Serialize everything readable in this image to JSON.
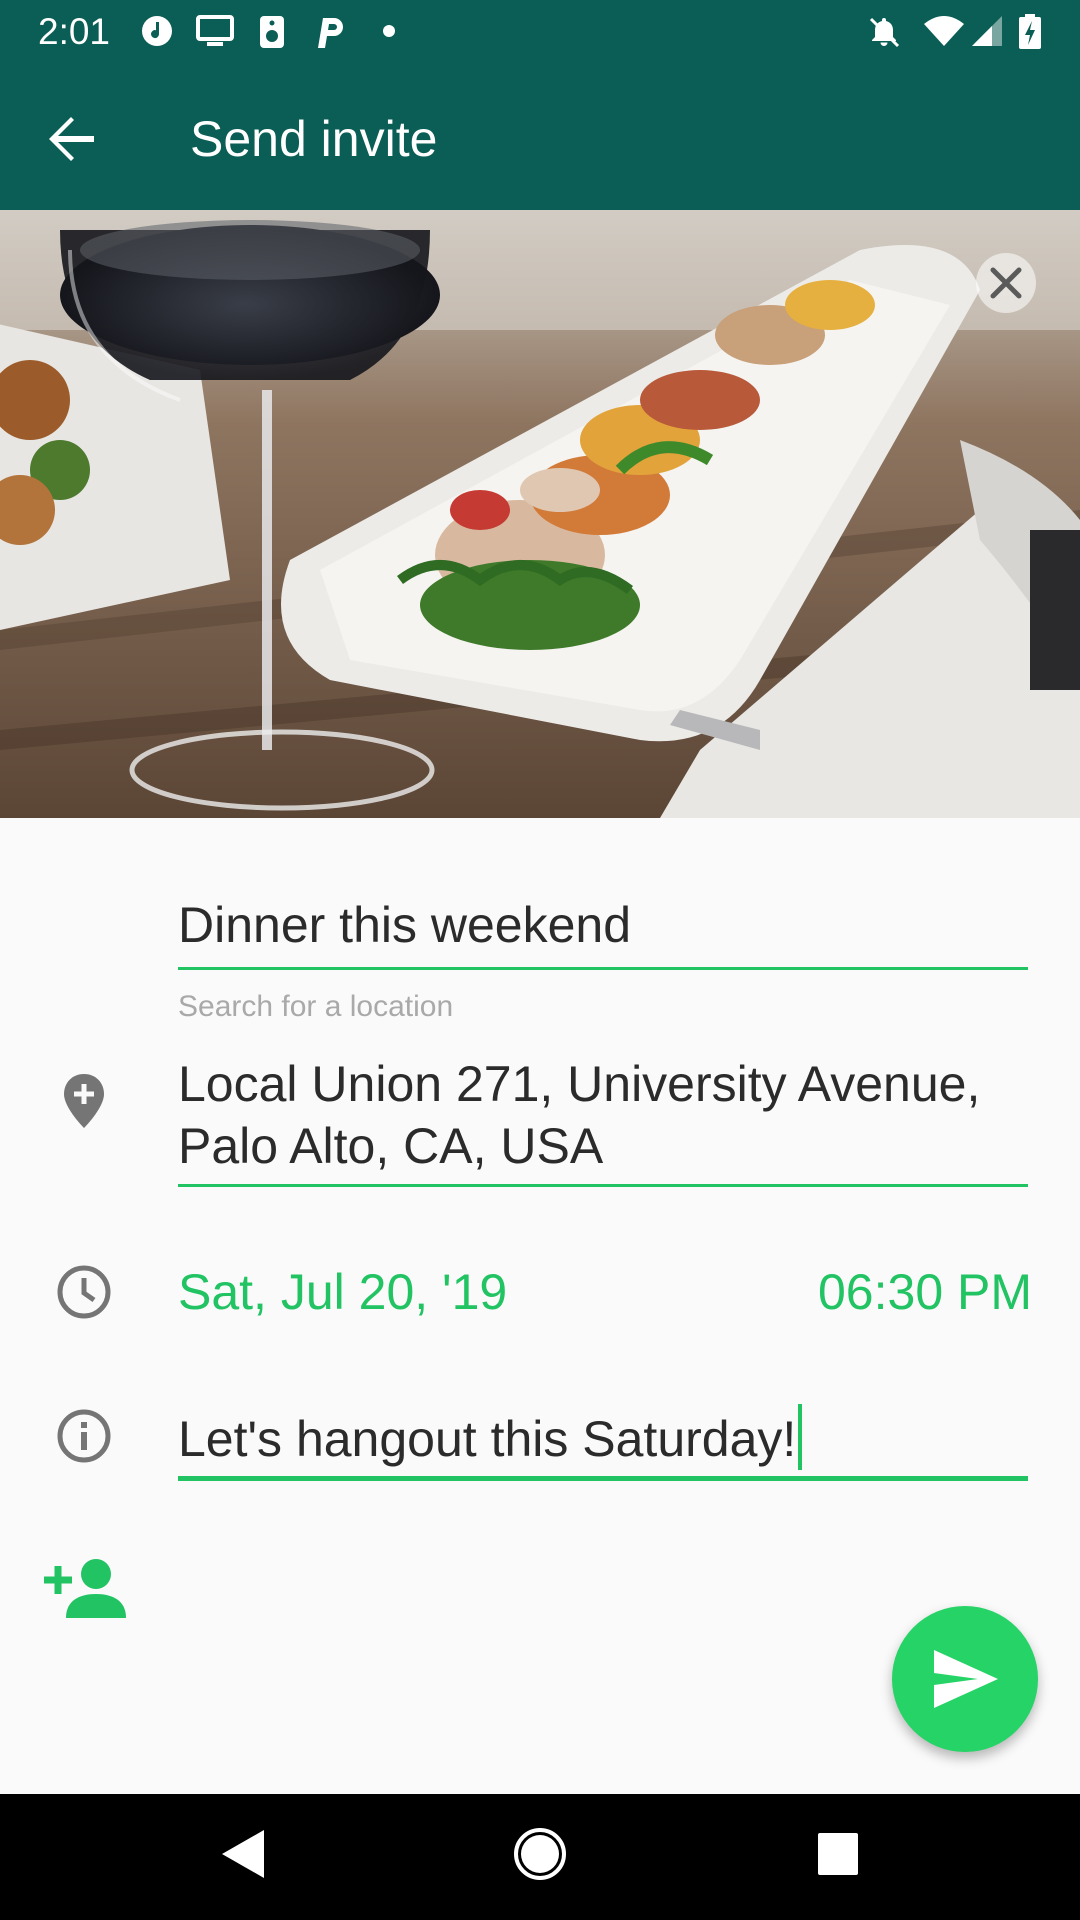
{
  "status_bar": {
    "time": "2:01",
    "left_icons": [
      "music-note-icon",
      "cast-screen-icon",
      "speaker-icon",
      "p-app-icon",
      "dot-icon"
    ],
    "right_icons": [
      "notifications-off-icon",
      "wifi-icon",
      "signal-icon",
      "battery-charging-icon"
    ]
  },
  "app_bar": {
    "back_icon": "arrow-back-icon",
    "title": "Send invite"
  },
  "hero": {
    "image_alt": "Dinner plate with wine glass",
    "close_icon": "close-icon"
  },
  "form": {
    "title_value": "Dinner this weekend",
    "location_hint": "Search for a location",
    "location_line1": "Local Union 271, University Avenue,",
    "location_line2": "Palo Alto, CA, USA",
    "date": "Sat, Jul 20, '19",
    "time": "06:30 PM",
    "note_value": "Let's hangout this Saturday!",
    "location_icon": "add-location-icon",
    "time_icon": "clock-icon",
    "note_icon": "info-icon",
    "add_person_icon": "person-add-icon"
  },
  "fab": {
    "icon": "send-icon"
  },
  "nav_bar": {
    "back": "nav-back-icon",
    "home": "nav-home-icon",
    "recents": "nav-recents-icon"
  },
  "colors": {
    "primary_dark": "#0B5E55",
    "accent": "#22C363",
    "fab": "#25D366",
    "background": "#FAFAFA"
  }
}
